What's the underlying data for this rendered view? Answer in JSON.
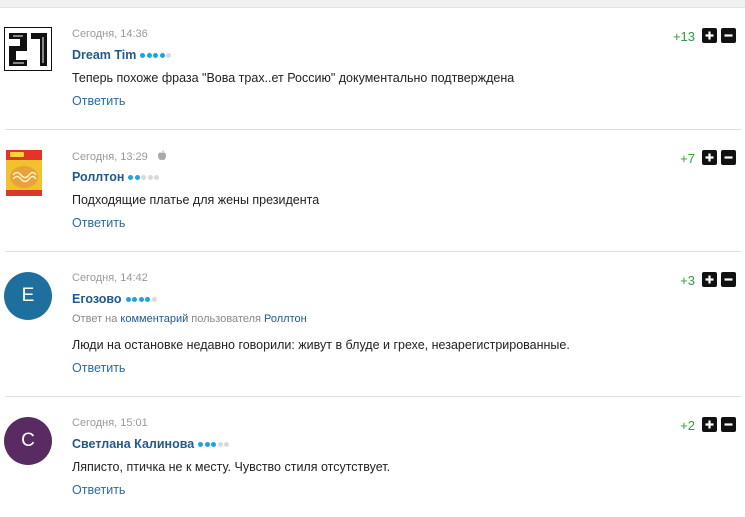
{
  "comments": [
    {
      "date": "Сегодня, 14:36",
      "author": "Dream Tim",
      "avatar_text": "21",
      "rating": "+13",
      "text": "Теперь похоже фраза \"Вова трах..ет Россию\" документально подтверждена",
      "reply_label": "Ответить",
      "dots_filled": 4
    },
    {
      "date": "Сегодня, 13:29",
      "author": "Роллтон",
      "platform_icon": "apple-icon",
      "rating": "+7",
      "text": "Подходящие платье для жены президента",
      "reply_label": "Ответить",
      "dots_filled": 2
    },
    {
      "date": "Сегодня, 14:42",
      "author": "Егозово",
      "avatar_letter": "Е",
      "avatar_color": "#1f6f9e",
      "rating": "+3",
      "reply_to": {
        "prefix": "Ответ на",
        "link": "комментарий",
        "middle": "пользователя",
        "user": "Роллтон"
      },
      "text": "Люди на остановке недавно говорили: живут в блуде и грехе, незарегистрированные.",
      "reply_label": "Ответить",
      "dots_filled": 4
    },
    {
      "date": "Сегодня, 15:01",
      "author": "Светлана Калинова",
      "avatar_letter": "С",
      "avatar_color": "#5a2a63",
      "rating": "+2",
      "text": "Ляписто, птичка не к месту. Чувство стиля отсутствует.",
      "reply_label": "Ответить",
      "dots_filled": 3
    }
  ],
  "colors": {
    "author": "#23598c",
    "rating": "#2e9e3a",
    "dot_on": "#1fa3e0",
    "dot_off": "#d9d9d9"
  }
}
